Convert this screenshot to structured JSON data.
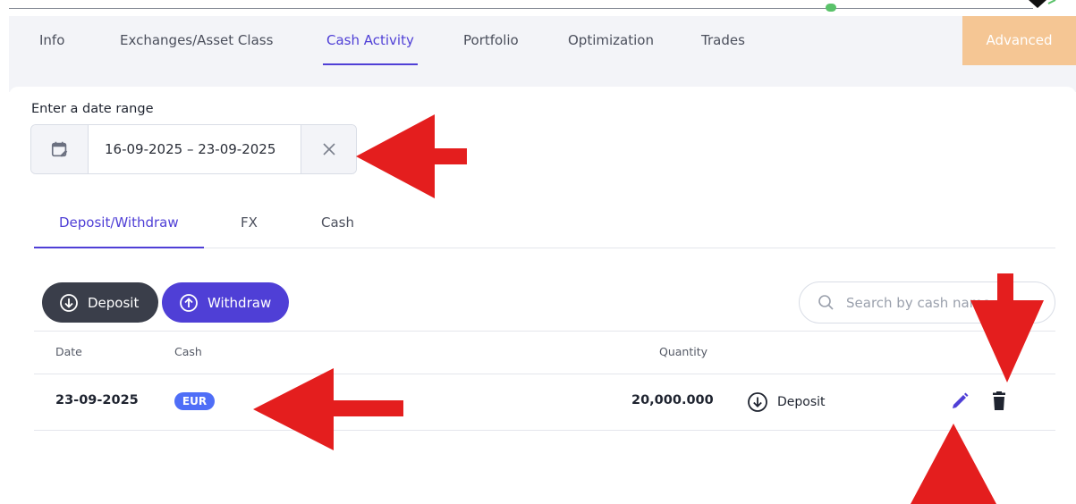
{
  "tabs": [
    {
      "label": "Info"
    },
    {
      "label": "Exchanges/Asset Class"
    },
    {
      "label": "Cash Activity"
    },
    {
      "label": "Portfolio"
    },
    {
      "label": "Optimization"
    },
    {
      "label": "Trades"
    }
  ],
  "active_tab": "Cash Activity",
  "advanced_label": "Advanced",
  "date_range": {
    "label": "Enter a date range",
    "value": "16-09-2025 – 23-09-2025"
  },
  "subtabs": [
    {
      "label": "Deposit/Withdraw"
    },
    {
      "label": "FX"
    },
    {
      "label": "Cash"
    }
  ],
  "active_subtab": "Deposit/Withdraw",
  "actions": {
    "deposit_label": "Deposit",
    "withdraw_label": "Withdraw"
  },
  "search": {
    "placeholder": "Search by cash name"
  },
  "table": {
    "columns": [
      "Date",
      "Cash",
      "Quantity"
    ],
    "rows": [
      {
        "date": "23-09-2025",
        "cash": "EUR",
        "quantity": "20,000.000",
        "type": "Deposit"
      }
    ]
  },
  "colors": {
    "accent": "#4f3fd6",
    "dark_button": "#3a3e4a",
    "advanced_bg": "#f5c694",
    "badge": "#4f6ef7",
    "annotation_arrow": "#e41e1e"
  },
  "icons": [
    "calendar-edit-icon",
    "close-icon",
    "arrow-down-circle-icon",
    "arrow-up-circle-icon",
    "search-icon",
    "pencil-icon",
    "trash-icon"
  ]
}
